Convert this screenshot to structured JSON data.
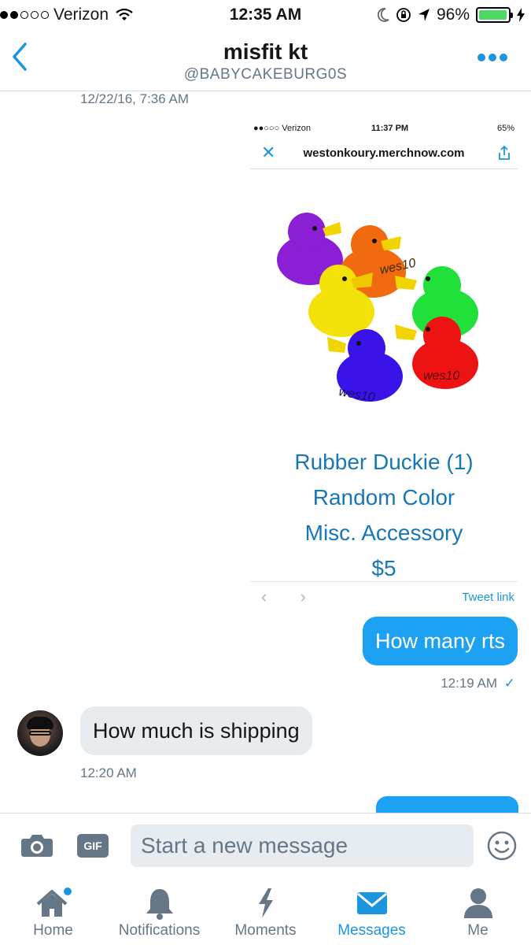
{
  "status_bar": {
    "carrier": "Verizon",
    "time": "12:35 AM",
    "battery": "96%"
  },
  "header": {
    "title": "misfit kt",
    "handle": "@BABYCAKEBURG0S"
  },
  "conversation": {
    "first_timestamp": "12/22/16, 7:36 AM",
    "card": {
      "mini_status": {
        "carrier": "Verizon",
        "time": "11:37 PM",
        "battery": "65%"
      },
      "url": "westonkoury.merchnow.com",
      "product_lines": [
        "Rubber Duckie (1)",
        "Random Color",
        "Misc. Accessory",
        "$5"
      ],
      "duck_label": "wes10",
      "tweet_link": "Tweet link"
    },
    "messages": [
      {
        "direction": "sent",
        "text": "How many rts",
        "time": "12:19 AM",
        "read": "✓"
      },
      {
        "direction": "received",
        "text": "How much is shipping",
        "time": "12:20 AM"
      }
    ]
  },
  "composer": {
    "gif_label": "GIF",
    "placeholder": "Start a new message"
  },
  "tabbar": {
    "items": [
      {
        "label": "Home",
        "icon": "home-icon",
        "badge": true
      },
      {
        "label": "Notifications",
        "icon": "bell-icon"
      },
      {
        "label": "Moments",
        "icon": "lightning-icon"
      },
      {
        "label": "Messages",
        "icon": "envelope-icon",
        "active": true
      },
      {
        "label": "Me",
        "icon": "person-icon"
      }
    ]
  },
  "colors": {
    "accent": "#1b95e0",
    "sent_bubble": "#1da1f2",
    "received_bubble": "#e6ecf0",
    "muted_text": "#657786"
  }
}
